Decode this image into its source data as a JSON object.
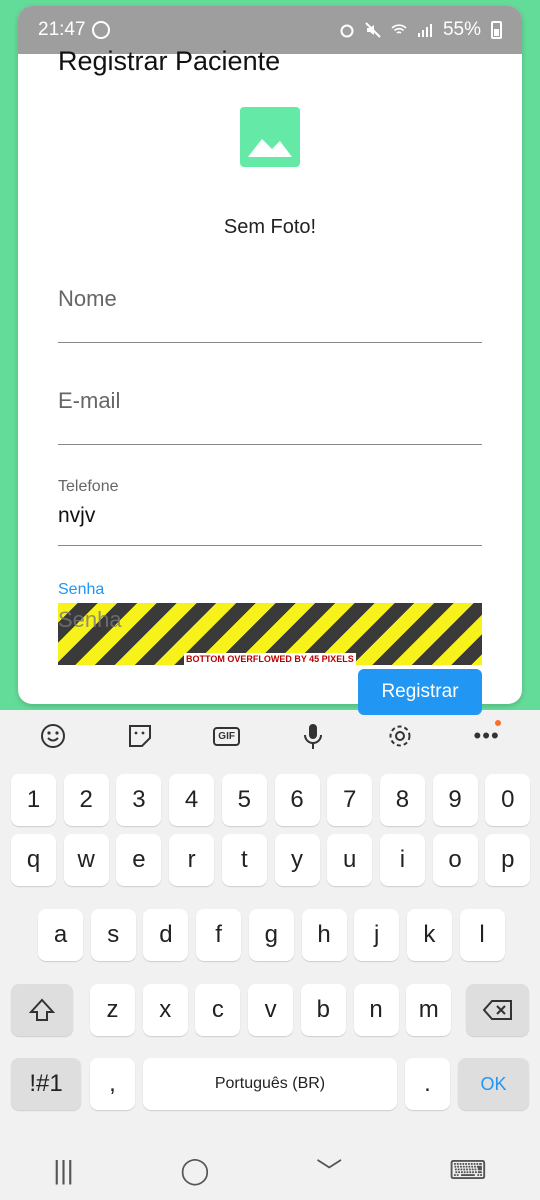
{
  "status": {
    "time": "21:47",
    "battery": "55%"
  },
  "title": "Registrar Paciente",
  "photo": {
    "caption": "Sem Foto!"
  },
  "fields": {
    "nome": {
      "placeholder": "Nome"
    },
    "email": {
      "placeholder": "E-mail"
    },
    "telefone": {
      "label": "Telefone",
      "value": "nvjv"
    },
    "senha": {
      "label": "Senha",
      "placeholder": "Senha"
    }
  },
  "overflow_banner": "BOTTOM OVERFLOWED BY 45 PIXELS",
  "register_button": "Registrar",
  "keyboard": {
    "toolbar": [
      "emoji-icon",
      "sticker-icon",
      "gif-icon",
      "mic-icon",
      "settings-icon",
      "more-icon"
    ],
    "gif_label": "GIF",
    "row_numbers": [
      "1",
      "2",
      "3",
      "4",
      "5",
      "6",
      "7",
      "8",
      "9",
      "0"
    ],
    "row_q": [
      "q",
      "w",
      "e",
      "r",
      "t",
      "y",
      "u",
      "i",
      "o",
      "p"
    ],
    "row_a": [
      "a",
      "s",
      "d",
      "f",
      "g",
      "h",
      "j",
      "k",
      "l"
    ],
    "row_z": [
      "z",
      "x",
      "c",
      "v",
      "b",
      "n",
      "m"
    ],
    "symbols_key": "!#1",
    "comma_key": ",",
    "space_label": "Português (BR)",
    "period_key": ".",
    "ok_key": "OK"
  },
  "navbar": {
    "recent": "|||",
    "home": "◯",
    "back": "﹀",
    "keyboard": "⌨"
  }
}
